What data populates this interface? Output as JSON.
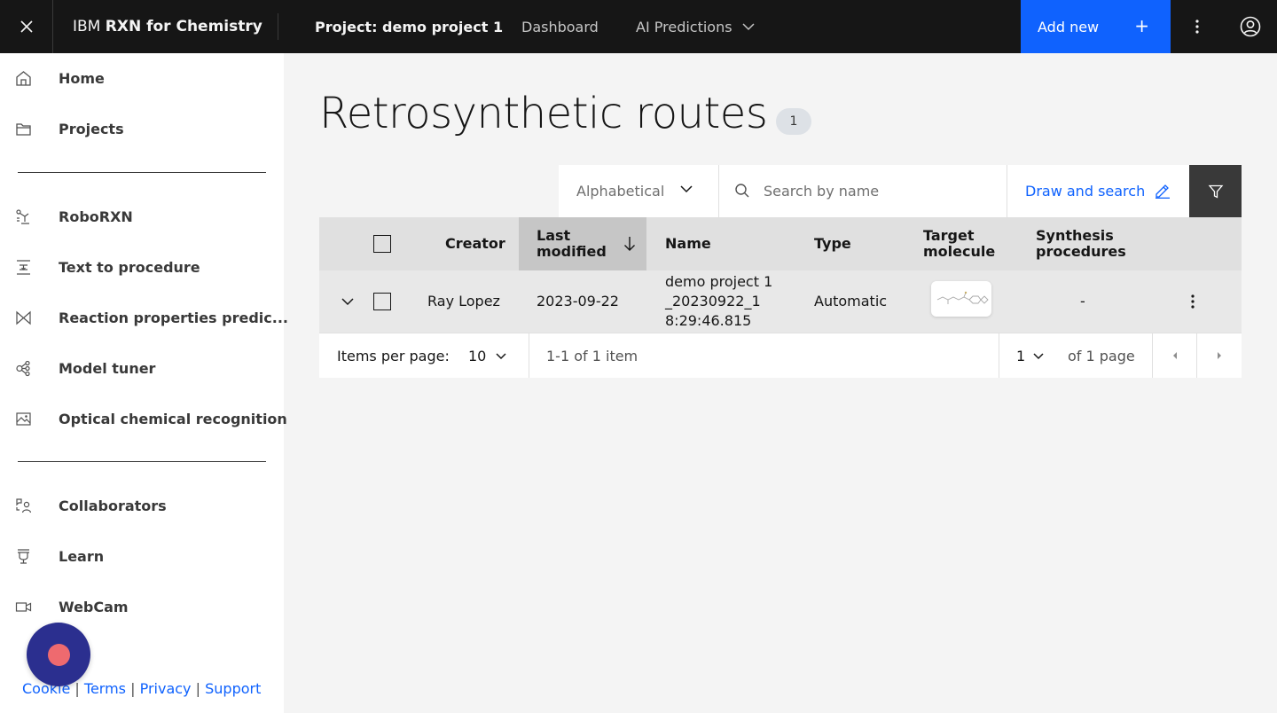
{
  "header": {
    "close_label": "close",
    "brand_prefix": "IBM",
    "brand_name": "RXN for Chemistry",
    "project": "Project: demo project 1",
    "nav": {
      "dashboard": "Dashboard",
      "ai_predictions": "AI Predictions"
    },
    "add_new": "Add new",
    "add_new_symbol": "+"
  },
  "sidebar": {
    "items": [
      {
        "label": "Home",
        "icon": "home-icon"
      },
      {
        "label": "Projects",
        "icon": "folder-icon"
      },
      {
        "label": "RoboRXN",
        "icon": "robot-arm-icon"
      },
      {
        "label": "Text to procedure",
        "icon": "text-procedure-icon"
      },
      {
        "label": "Reaction properties predic...",
        "icon": "reaction-properties-icon"
      },
      {
        "label": "Model tuner",
        "icon": "model-tuner-icon"
      },
      {
        "label": "Optical chemical recognition",
        "icon": "image-recognition-icon"
      },
      {
        "label": "Collaborators",
        "icon": "collaborators-icon"
      },
      {
        "label": "Learn",
        "icon": "learn-icon"
      },
      {
        "label": "WebCam",
        "icon": "webcam-icon"
      }
    ],
    "footer": {
      "cookie": "Cookie",
      "terms": "Terms",
      "privacy": "Privacy",
      "support": "Support",
      "sep": "|"
    }
  },
  "main": {
    "title": "Retrosynthetic routes",
    "count": "1",
    "sort": {
      "selected": "Alphabetical"
    },
    "search": {
      "placeholder": "Search by name",
      "value": ""
    },
    "draw_search": "Draw and search",
    "table": {
      "headers": {
        "creator": "Creator",
        "last_modified_1": "Last",
        "last_modified_2": "modified",
        "name": "Name",
        "type": "Type",
        "target_1": "Target",
        "target_2": "molecule",
        "synth_1": "Synthesis",
        "synth_2": "procedures"
      },
      "rows": [
        {
          "creator": "Ray Lopez",
          "last_modified": "2023-09-22",
          "name_1": "demo project 1",
          "name_2": "_20230922_1",
          "name_3": "8:29:46.815",
          "type": "Automatic",
          "synthesis_procedures": "-"
        }
      ]
    },
    "pagination": {
      "items_per_page_label": "Items per page:",
      "items_per_page": "10",
      "range": "1-1 of 1 item",
      "page": "1",
      "of_pages": "of 1 page"
    }
  },
  "colors": {
    "header_bg": "#161616",
    "primary": "#0f62fe",
    "chat_bubble": "#2b2f8f",
    "chat_dot": "#ee6a6f"
  }
}
